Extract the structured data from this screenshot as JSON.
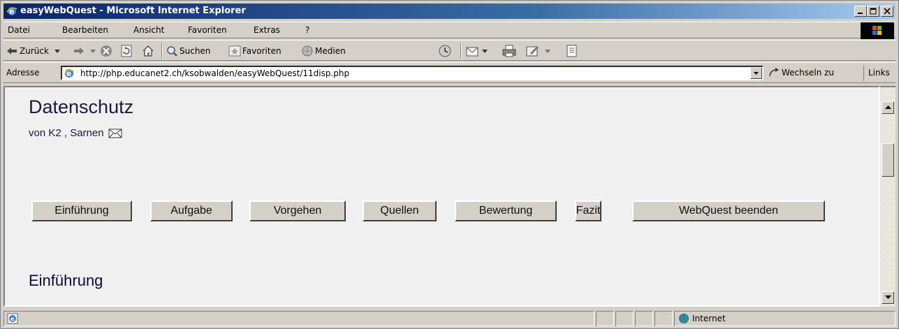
{
  "window": {
    "title": "easyWebQuest - Microsoft Internet Explorer"
  },
  "menu": {
    "items": [
      "Datei",
      "Bearbeiten",
      "Ansicht",
      "Favoriten",
      "Extras",
      "?"
    ]
  },
  "toolbar": {
    "back_label": "Zurück",
    "search_label": "Suchen",
    "favorites_label": "Favoriten",
    "media_label": "Medien"
  },
  "address": {
    "label": "Adresse",
    "url": "http://php.educanet2.ch/ksobwalden/easyWebQuest/11disp.php",
    "go_label": "Wechseln zu",
    "links_label": "Links"
  },
  "page": {
    "title": "Datenschutz",
    "byline": "von K2 , Sarnen",
    "nav_buttons": [
      "Einführung",
      "Aufgabe",
      "Vorgehen",
      "Quellen",
      "Bewertung",
      "Fazit",
      "WebQuest beenden"
    ],
    "section_heading": "Einführung"
  },
  "status": {
    "zone_label": "Internet"
  },
  "colors": {
    "titlebar_start": "#0a246a",
    "titlebar_end": "#a6caf0",
    "chrome": "#d4d0c8",
    "page_bg": "#f0f0f0",
    "page_text": "#1a1a3a"
  }
}
